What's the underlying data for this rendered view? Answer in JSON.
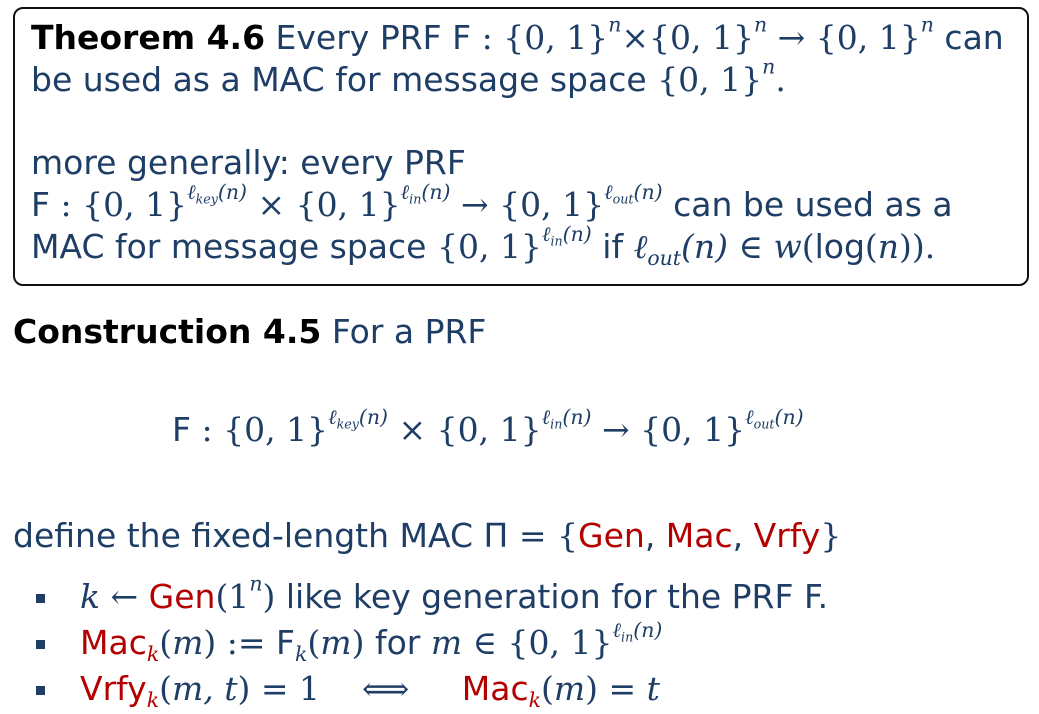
{
  "theorem": {
    "title": "Theorem 4.6",
    "line1_prefix": "Every PRF F",
    "line1_suffix": "can",
    "line2_prefix": "be used as a MAC for message space",
    "line3": "more generally: every PRF",
    "line4_prefix": "F",
    "line4_suffix": "can be used as a",
    "line5_prefix": "MAC for message space",
    "line5_if": "if",
    "line5_log": "log"
  },
  "construction": {
    "title": "Construction 4.5",
    "intro": "For a PRF",
    "display_prefix": "F"
  },
  "definition": {
    "prefix": "define the fixed-length MAC",
    "pi": "Π",
    "gen": "Gen",
    "mac": "Mac",
    "vrfy": "Vrfy"
  },
  "bullets": [
    {
      "gen": "Gen",
      "text": "like key generation for the PRF F."
    },
    {
      "mac": "Mac",
      "f": "F",
      "for": "for"
    },
    {
      "vrfy": "Vrfy",
      "mac": "Mac"
    }
  ]
}
